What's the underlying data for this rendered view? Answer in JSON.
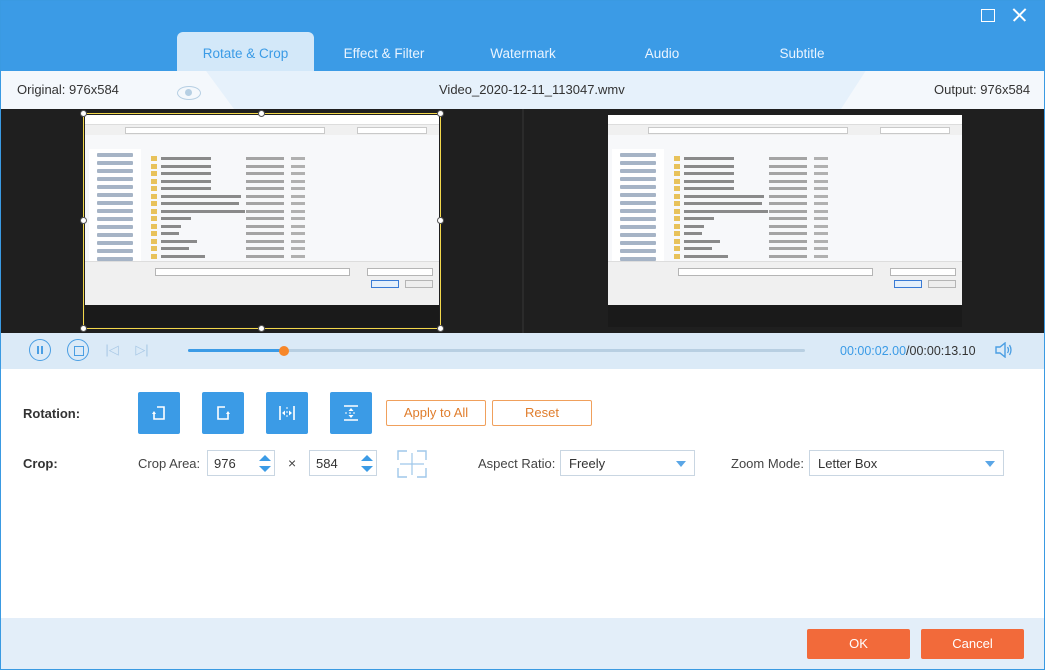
{
  "tabs": [
    {
      "label": "Rotate & Crop",
      "active": true
    },
    {
      "label": "Effect & Filter",
      "active": false
    },
    {
      "label": "Watermark",
      "active": false
    },
    {
      "label": "Audio",
      "active": false
    },
    {
      "label": "Subtitle",
      "active": false
    }
  ],
  "preview": {
    "original_label": "Original: 976x584",
    "filename": "Video_2020-12-11_113047.wmv",
    "output_label": "Output: 976x584"
  },
  "playback": {
    "current_time": "00:00:02.00",
    "separator": "/",
    "total_time": "00:00:13.10",
    "progress": 0.155
  },
  "rotation": {
    "label": "Rotation:",
    "buttons": [
      "rotate-left",
      "rotate-right",
      "flip-horizontal",
      "flip-vertical"
    ],
    "apply_all": "Apply to All",
    "reset": "Reset"
  },
  "crop": {
    "label": "Crop:",
    "area_label": "Crop Area:",
    "width": "976",
    "height": "584",
    "times": "×",
    "aspect_label": "Aspect Ratio:",
    "aspect_value": "Freely",
    "zoom_label": "Zoom Mode:",
    "zoom_value": "Letter Box"
  },
  "footer": {
    "ok": "OK",
    "cancel": "Cancel"
  },
  "colors": {
    "accent": "#3b9be6",
    "orange": "#f26a3a"
  }
}
